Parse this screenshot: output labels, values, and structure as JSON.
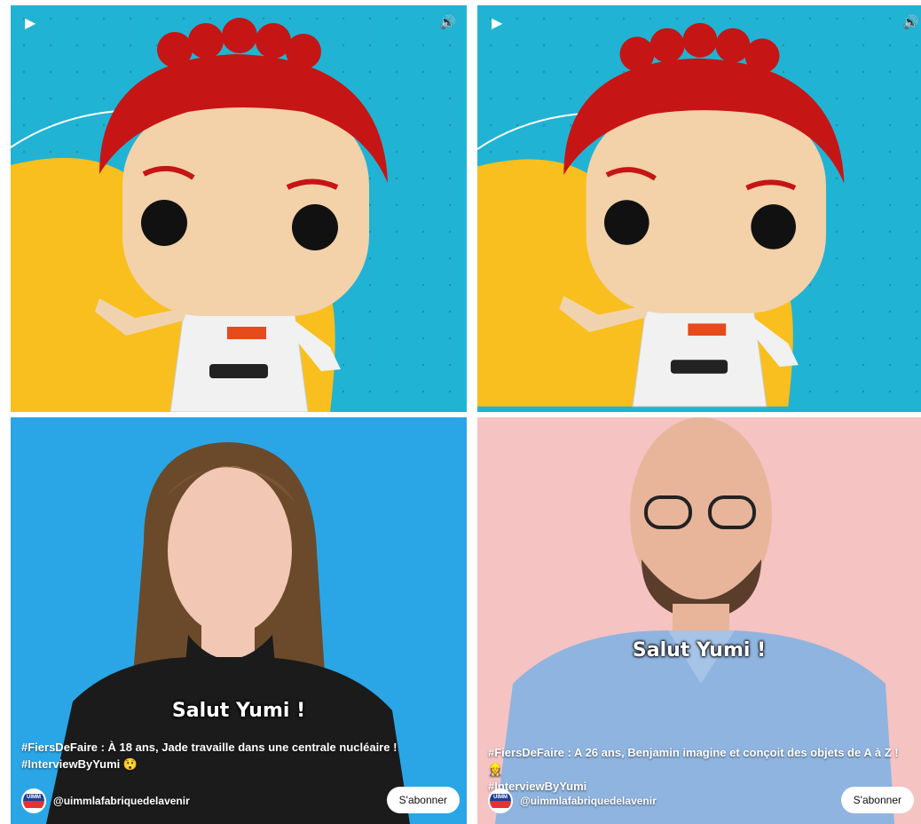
{
  "shorts": [
    {
      "controls": {
        "play": "▶",
        "volume": "🔊"
      }
    },
    {
      "controls": {
        "play": "▶",
        "volume": "🔊"
      }
    },
    {
      "caption": "Salut Yumi !",
      "title_line1": "#FiersDeFaire : À 18 ans, Jade travaille dans une centrale nucléaire !",
      "title_line2": "#InterviewByYumi 😲",
      "channel": "@uimmlafabriquedelavenir",
      "subscribe": "S'abonner",
      "avatar_text": "UIMM"
    },
    {
      "caption": "Salut Yumi !",
      "title_line1": "#FiersDeFaire : A 26 ans, Benjamin imagine et conçoit des objets de A à Z ! 👷",
      "title_line2": "#InterviewByYumi",
      "channel": "@uimmlafabriquedelavenir",
      "subscribe": "S'abonner",
      "avatar_text": "UIMM"
    }
  ],
  "colors": {
    "teal_bg": "#21b3d3",
    "yellow_blob": "#f9bf1e",
    "blue_bg": "#2aa6e6",
    "pink_bg": "#f4c3c2",
    "hair_red": "#c61515"
  }
}
